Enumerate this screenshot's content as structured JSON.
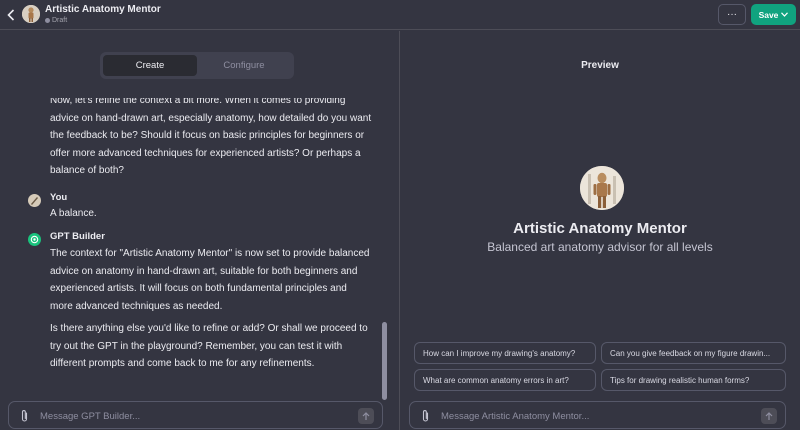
{
  "header": {
    "title": "Artistic Anatomy Mentor",
    "status": "Draft",
    "more_label": "···",
    "save_label": "Save"
  },
  "tabs": [
    {
      "label": "Create",
      "active": true
    },
    {
      "label": "Configure",
      "active": false
    }
  ],
  "chat": {
    "builder_intro": "Now, let's refine the context a bit more. When it comes to providing advice on hand-drawn art, especially anatomy, how detailed do you want the feedback to be? Should it focus on basic principles for beginners or offer more advanced techniques for experienced artists? Or perhaps a balance of both?",
    "user_name": "You",
    "user_message": "A balance.",
    "builder_name": "GPT Builder",
    "builder_reply_1": "The context for \"Artistic Anatomy Mentor\" is now set to provide balanced advice on anatomy in hand-drawn art, suitable for both beginners and experienced artists. It will focus on both fundamental principles and more advanced techniques as needed.",
    "builder_reply_2": "Is there anything else you'd like to refine or add? Or shall we proceed to try out the GPT in the playground? Remember, you can test it with different prompts and come back to me for any refinements."
  },
  "builder_input": {
    "placeholder": "Message GPT Builder..."
  },
  "preview": {
    "heading": "Preview",
    "gpt_name": "Artistic Anatomy Mentor",
    "gpt_description": "Balanced art anatomy advisor for all levels",
    "starters": [
      "How can I improve my drawing's anatomy?",
      "Can you give feedback on my figure drawin...",
      "What are common anatomy errors in art?",
      "Tips for drawing realistic human forms?"
    ],
    "input_placeholder": "Message Artistic Anatomy Mentor..."
  },
  "colors": {
    "background": "#343541",
    "accent": "#10a37f",
    "border": "#565869"
  }
}
